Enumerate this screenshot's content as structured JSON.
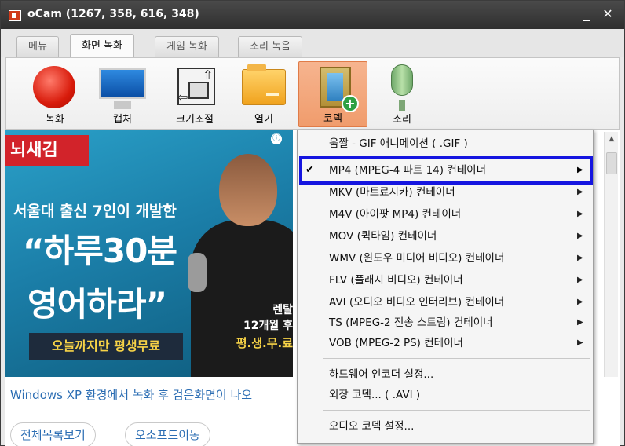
{
  "window": {
    "title": "oCam (1267, 358, 616, 348)",
    "minimize_glyph": "_",
    "close_glyph": "✕"
  },
  "tabs": [
    {
      "label": "메뉴"
    },
    {
      "label": "화면 녹화",
      "active": true
    },
    {
      "label": "게임 녹화"
    },
    {
      "label": "소리 녹음"
    }
  ],
  "toolbar": {
    "record": "녹화",
    "capture": "캡처",
    "resize": "크기조절",
    "open": "열기",
    "codec": "코덱",
    "sound": "소리"
  },
  "banner": {
    "logo": "뇌새김",
    "info_glyph": "ⓘ",
    "line1": "서울대 출신 7인이 개발한",
    "line2": "“하루30분",
    "line3": "영어하라”",
    "cta": "오늘까지만 평생무료",
    "rental1": "렌탈",
    "rental2": "12개월 후",
    "rental3": "평.생.무.료"
  },
  "content": {
    "link_text": "Windows XP 환경에서 녹화 후 검은화면이 나오",
    "pill1": "전체목록보기",
    "pill2": "오소프트이동"
  },
  "menu": {
    "items": [
      {
        "label": "움짤 - GIF 애니메이션 ( .GIF )"
      },
      {
        "label": "MP4 (MPEG-4 파트 14) 컨테이너",
        "checked": true,
        "submenu": true,
        "highlighted": true
      },
      {
        "label": "MKV (마트료시카) 컨테이너",
        "submenu": true
      },
      {
        "label": "M4V (아이팟 MP4) 컨테이너",
        "submenu": true
      },
      {
        "label": "MOV (퀵타임) 컨테이너",
        "submenu": true
      },
      {
        "label": "WMV (윈도우 미디어 비디오) 컨테이너",
        "submenu": true
      },
      {
        "label": "FLV (플래시 비디오) 컨테이너",
        "submenu": true
      },
      {
        "label": "AVI (오디오 비디오 인터리브) 컨테이너",
        "submenu": true
      },
      {
        "label": "TS (MPEG-2 전송 스트림) 컨테이너",
        "submenu": true
      },
      {
        "label": "VOB (MPEG-2 PS) 컨테이너",
        "submenu": true
      },
      {
        "label": "하드웨어 인코더 설정..."
      },
      {
        "label": "외장 코덱... ( .AVI )"
      },
      {
        "label": "오디오 코덱 설정..."
      }
    ],
    "check_glyph": "✔",
    "submenu_glyph": "▶"
  },
  "icons": [
    "app-icon",
    "record-icon",
    "monitor-icon",
    "resize-icon",
    "folder-icon",
    "codec-film-icon",
    "microphone-icon",
    "check-icon",
    "submenu-arrow-icon",
    "info-icon"
  ],
  "colors": {
    "highlight_border": "#1515e0",
    "codec_active_bg": "#f09c6c",
    "titlebar": "#3a3a3a"
  }
}
